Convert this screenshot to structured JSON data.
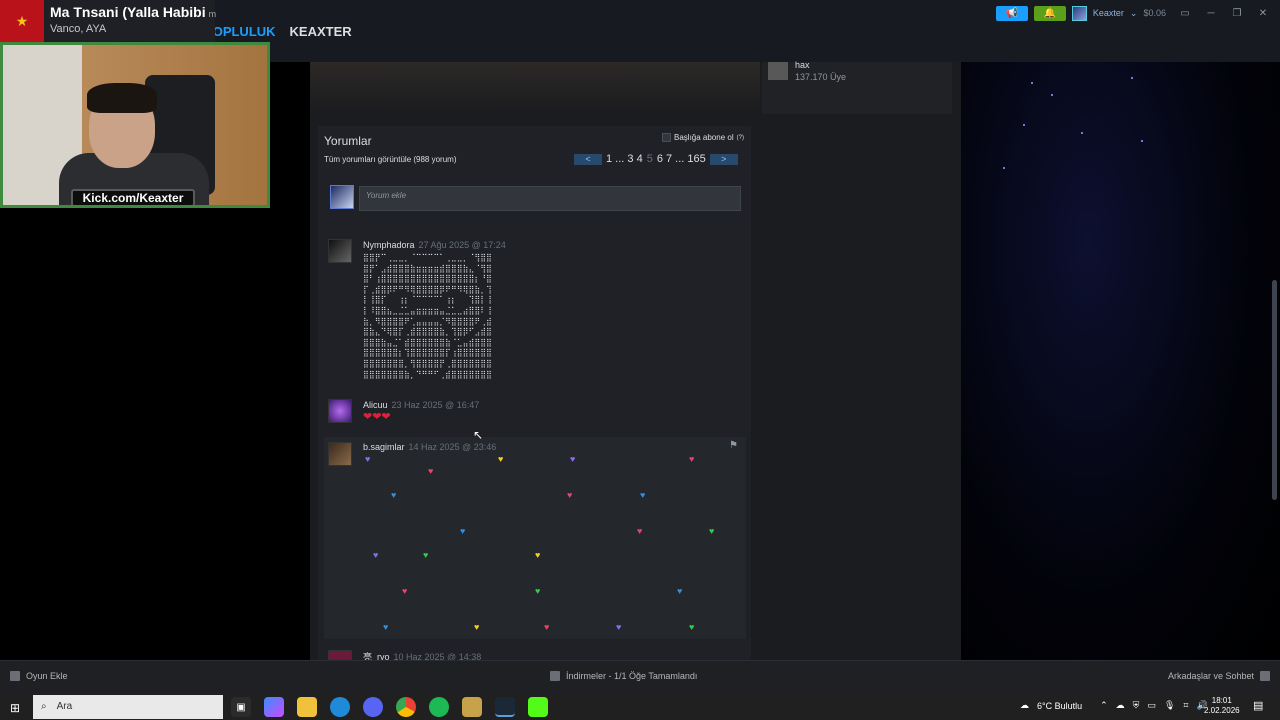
{
  "stream_overlay": {
    "song_title": "Ma Tnsani (Yalla Habibi",
    "song_suffix": "m",
    "song_artist": "Vanco, AYA",
    "webcam_label": "Kick.com/Keaxter"
  },
  "nav": {
    "items": [
      "TOPLULUK",
      "KEAXTER"
    ],
    "active": "TOPLULUK"
  },
  "account": {
    "username": "Keaxter",
    "balance": "$0.06",
    "dropdown_arrow": "⌄"
  },
  "group": {
    "name": "hax",
    "members": "137.170 Üye"
  },
  "comments": {
    "title": "Yorumlar",
    "subscribe_label": "Başlığa abone ol",
    "help_mark": "(?)",
    "view_all": "Tüm yorumları görüntüle (988 yorum)",
    "pagination": {
      "prev": "<",
      "next": ">",
      "pages_before": "1 ... 3 4",
      "current": "5",
      "pages_after": "6 7 ... 165"
    },
    "add_placeholder": "Yorum ekle",
    "items": [
      {
        "author": "Nymphadora",
        "time": "27 Ağu 2025 @ 17:24",
        "ascii_art": "⣿⣿⡟⠉⢀⣀⣀⡀⠈⠉⠉⠉⠉⠁⢀⣀⣀⡀⠈⢻⣿⣿\n⣿⡟⠁⣠⣾⣿⣿⣿⣷⣶⣶⣶⣶⣾⣿⣿⣿⣷⣄⠈⢻⣿\n⣿⠃⢰⣿⣿⣿⣿⣿⣿⣿⣿⣿⣿⣿⣿⣿⣿⣿⣿⡆⠘⣿\n⡏⢀⣾⣿⡿⠟⠛⠻⢿⣿⣿⣿⣿⡿⠟⠛⠻⢿⣿⣷⡀⢹\n⡇⢸⣿⡏⠀⠀⢰⡆⠈⠉⠉⠉⠉⠁⢰⡆⠀⠀⢹⣿⡇⢸\n⡇⠸⣿⣿⣦⣀⣈⣁⣤⣶⣶⣶⣶⣤⣈⣁⣀⣴⣿⣿⠇⢸\n⣷⡀⠻⣿⣿⣿⣿⠟⢁⣤⣤⣤⣤⡈⠻⣿⣿⣿⣿⠟⢀⣾\n⣿⣷⣄⠙⢿⣿⡏⢀⣾⣿⣿⣿⣿⣷⡀⢹⣿⡿⠋⣠⣾⣿\n⣿⣿⣿⣷⣤⣈⠁⣾⣿⣿⣿⣿⣿⣿⣷⠈⣁⣤⣾⣿⣿⣿\n⣿⣿⣿⣿⣿⣿⡆⢹⣿⣿⣿⣿⣿⣿⡏⢰⣿⣿⣿⣿⣿⣿\n⣿⣿⣿⣿⣿⣿⣿⡀⢻⣿⣿⣿⣿⡟⢀⣿⣿⣿⣿⣿⣿⣿\n⣿⣿⣿⣿⣿⣿⣿⣷⡀⠙⠛⠛⠋⢀⣾⣿⣿⣿⣿⣿⣿⣿"
      },
      {
        "author": "Alicuu",
        "time": "23 Haz 2025 @ 16:47",
        "text": "❤❤❤"
      },
      {
        "author": "b.sagimlar",
        "time": "14 Haz 2025 @ 23:46"
      },
      {
        "author": "亮_ryo",
        "time": "10 Haz 2025 @ 14:38"
      }
    ]
  },
  "hearts": [
    {
      "c": "#8f6bf2"
    },
    {
      "c": "#e9436d"
    },
    {
      "c": "#f3d21b"
    },
    {
      "c": "#8f6bf2"
    },
    {
      "c": "#e9436d"
    },
    {
      "c": "#2f8fe0"
    },
    {
      "c": "#e9436d"
    },
    {
      "c": "#2f8fe0"
    },
    {
      "c": "#2f8fe0"
    },
    {
      "c": "#e9436d"
    },
    {
      "c": "#2fcf3f"
    },
    {
      "c": "#8f6bf2"
    },
    {
      "c": "#2fcf3f"
    },
    {
      "c": "#f3d21b"
    },
    {
      "c": "#e9436d"
    },
    {
      "c": "#2fcf3f"
    },
    {
      "c": "#2f8fe0"
    },
    {
      "c": "#2f8fe0"
    },
    {
      "c": "#f3d21b"
    },
    {
      "c": "#e9436d"
    },
    {
      "c": "#8f6bf2"
    },
    {
      "c": "#2fcf3f"
    }
  ],
  "steam_footer": {
    "add_game": "Oyun Ekle",
    "downloads": "İndirmeler - 1/1 Öğe Tamamlandı",
    "friends": "Arkadaşlar ve Sohbet"
  },
  "taskbar": {
    "search_placeholder": "Ara",
    "weather": "6°C Bulutlu",
    "time": "18:01",
    "date": "2.02.2026"
  },
  "colors": {
    "accent": "#1a9fff",
    "steam_bg": "#1b1c1f",
    "green_btn": "#5c9f1a"
  }
}
